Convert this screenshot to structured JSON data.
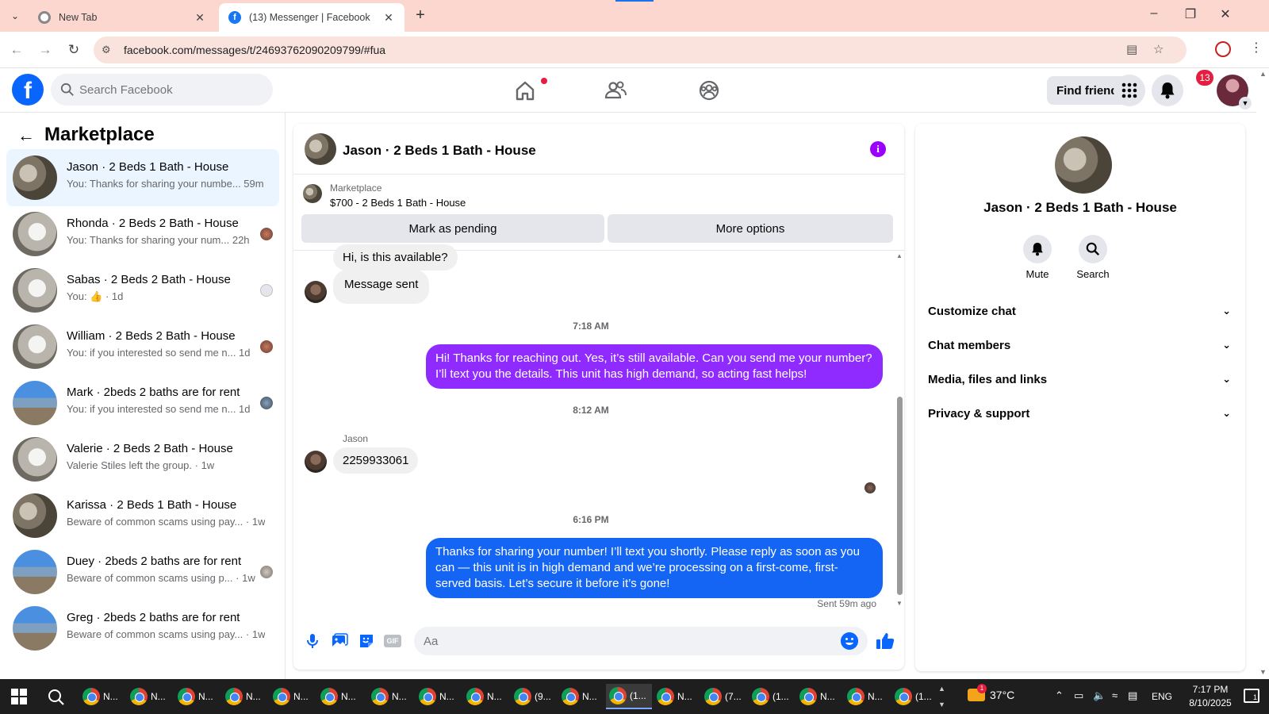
{
  "browser": {
    "tabs": [
      {
        "title": "New Tab"
      },
      {
        "title": "(13) Messenger | Facebook"
      }
    ],
    "url": "facebook.com/messages/t/24693762090209799/#fua"
  },
  "header": {
    "search_placeholder": "Search Facebook",
    "find_friends": "Find friends",
    "notification_count": "13"
  },
  "sidebar": {
    "title": "Marketplace",
    "conversations": [
      {
        "name": "Jason · 2 Beds 1 Bath - House",
        "preview": "You: Thanks for sharing your numbe... 59m",
        "thumb": "kitchen"
      },
      {
        "name": "Rhonda · 2 Beds 2 Bath - House",
        "preview": "You: Thanks for sharing your num... 22h",
        "thumb": "white"
      },
      {
        "name": "Sabas · 2 Beds 2 Bath - House",
        "preview_a": "You: ",
        "preview_b": " · 1d",
        "thumb": "white"
      },
      {
        "name": "William · 2 Beds 2 Bath - House",
        "preview": "You: if you interested so send me n... 1d",
        "thumb": "white"
      },
      {
        "name": "Mark · 2beds 2 baths are for rent",
        "preview": "You: if you interested so send me n... 1d",
        "thumb": "house"
      },
      {
        "name": "Valerie · 2 Beds 2 Bath - House",
        "preview": "Valerie Stiles left the group. · 1w",
        "thumb": "white"
      },
      {
        "name": "Karissa · 2 Beds 1 Bath - House",
        "preview": "Beware of common scams using pay... · 1w",
        "thumb": "kitchen"
      },
      {
        "name": "Duey · 2beds 2 baths are for rent",
        "preview": "Beware of common scams using p... · 1w",
        "thumb": "house"
      },
      {
        "name": "Greg · 2beds 2 baths are for rent",
        "preview": "Beware of common scams using pay... · 1w",
        "thumb": "house"
      }
    ]
  },
  "chat": {
    "title": "Jason · 2 Beds 1 Bath - House",
    "listing_label": "Marketplace",
    "listing_price": "$700 - 2 Beds 1 Bath - House",
    "mark_pending": "Mark as pending",
    "more_options": "More options",
    "messages": {
      "in1": "Hi, is this available?",
      "in2": "Message sent",
      "ts1": "7:18 AM",
      "out1": "Hi! Thanks for reaching out. Yes, it’s still available. Can you send me your number? I’ll text you the details. This unit has high demand, so acting fast helps!",
      "ts2": "8:12 AM",
      "sender": "Jason",
      "in3": "2259933061",
      "ts3": "6:16 PM",
      "out2": "Thanks for sharing your number! I’ll text you shortly. Please reply as soon as you can — this unit is in high demand and we’re processing on a first-come, first-served basis. Let’s secure it before it’s gone!",
      "status": "Sent 59m ago"
    },
    "composer_placeholder": "Aa",
    "gif_label": "GIF"
  },
  "details": {
    "name": "Jason · 2 Beds 1 Bath - House",
    "mute": "Mute",
    "search": "Search",
    "rows": [
      "Customize chat",
      "Chat members",
      "Media, files and links",
      "Privacy & support"
    ]
  },
  "taskbar": {
    "apps": [
      "N...",
      "N...",
      "N...",
      "N...",
      "N...",
      "N...",
      "N...",
      "N...",
      "N...",
      "(9...",
      "N...",
      "(1...",
      "N...",
      "(7...",
      "(1...",
      "N...",
      "N...",
      "(1..."
    ],
    "temperature": "37°C",
    "language": "ENG",
    "time": "7:17 PM",
    "date": "8/10/2025",
    "notif_count": "1",
    "weather_badge": "1"
  }
}
